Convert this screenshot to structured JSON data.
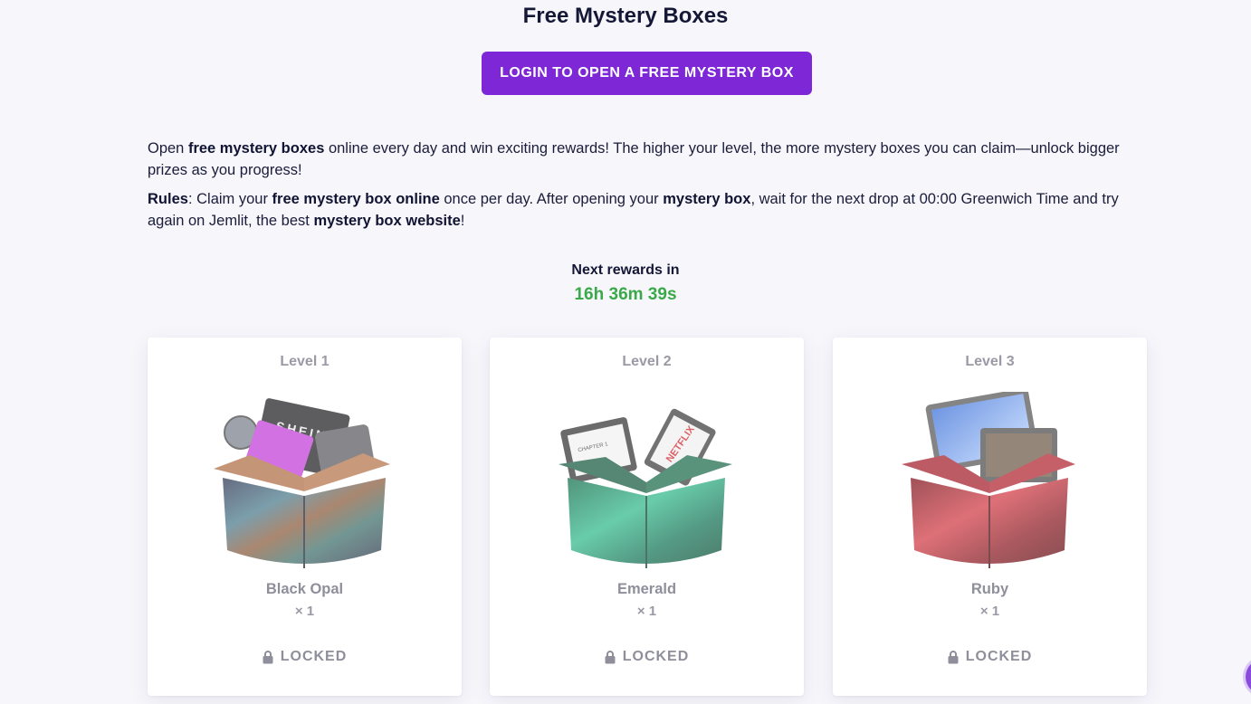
{
  "page": {
    "title": "Free Mystery Boxes",
    "login_button": "LOGIN TO OPEN A FREE MYSTERY BOX"
  },
  "intro": {
    "p1": [
      {
        "text": "Open ",
        "bold": false
      },
      {
        "text": "free mystery boxes",
        "bold": true
      },
      {
        "text": " online every day and win exciting rewards! The higher your level, the more mystery boxes you can claim—unlock bigger prizes as you progress!",
        "bold": false
      }
    ],
    "p2": [
      {
        "text": "Rules",
        "bold": true
      },
      {
        "text": ": Claim your ",
        "bold": false
      },
      {
        "text": "free mystery box online",
        "bold": true
      },
      {
        "text": " once per day. After opening your ",
        "bold": false
      },
      {
        "text": "mystery box",
        "bold": true
      },
      {
        "text": ", wait for the next drop at 00:00 Greenwich Time and try again on Jemlit, the best ",
        "bold": false
      },
      {
        "text": "mystery box website",
        "bold": true
      },
      {
        "text": "!",
        "bold": false
      }
    ]
  },
  "timer": {
    "label": "Next rewards in",
    "value": "16h 36m 39s",
    "color": "#3aa94a"
  },
  "cards": [
    {
      "level": "Level 1",
      "name": "Black Opal",
      "qty": "× 1",
      "status": "LOCKED",
      "art": "black-opal-box",
      "items_text": [
        "SHEIN"
      ]
    },
    {
      "level": "Level 2",
      "name": "Emerald",
      "qty": "× 1",
      "status": "LOCKED",
      "art": "emerald-box",
      "items_text": [
        "CHAPTER 1",
        "NETFLIX"
      ]
    },
    {
      "level": "Level 3",
      "name": "Ruby",
      "qty": "× 1",
      "status": "LOCKED",
      "art": "ruby-box",
      "items_text": []
    }
  ],
  "colors": {
    "accent": "#7d27d6",
    "background": "#f7f6fb",
    "timer": "#3aa94a",
    "muted": "#8f8f9b"
  }
}
